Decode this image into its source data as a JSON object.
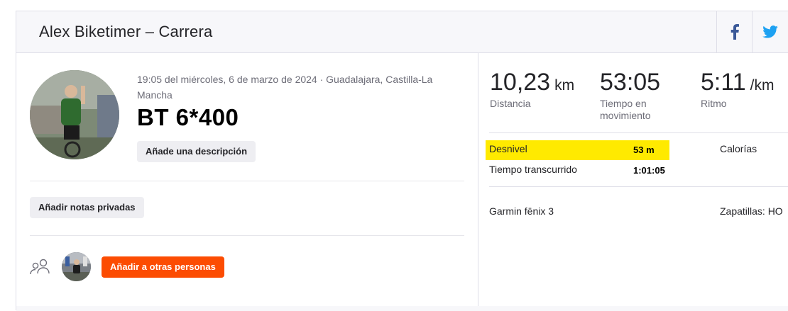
{
  "header": {
    "title": "Alex Biketimer – Carrera",
    "share_icons": [
      "facebook-icon",
      "twitter-icon"
    ],
    "facebook_color": "#3b5998",
    "twitter_color": "#1da1f2"
  },
  "activity": {
    "meta": "19:05 del miércoles, 6 de marzo de 2024 · Guadalajara, Castilla-La Mancha",
    "title": "BT 6*400",
    "add_description_label": "Añade una descripción",
    "add_private_notes_label": "Añadir notas privadas",
    "add_people_label": "Añadir a otras personas",
    "accent_color": "#fc4c02"
  },
  "stats": {
    "distance": {
      "value": "10,23",
      "unit": "km",
      "label": "Distancia"
    },
    "moving_time": {
      "value": "53:05",
      "label": "Tiempo en movimiento"
    },
    "pace": {
      "value": "5:11",
      "unit": "/km",
      "label": "Ritmo"
    }
  },
  "details": {
    "elevation_label": "Desnivel",
    "elevation_value": "53 m",
    "calories_label": "Calorías",
    "elapsed_label": "Tiempo transcurrido",
    "elapsed_value": "1:01:05",
    "device": "Garmin fēnix 3",
    "gear": "Zapatillas: HO",
    "highlight_color": "#ffea00"
  }
}
